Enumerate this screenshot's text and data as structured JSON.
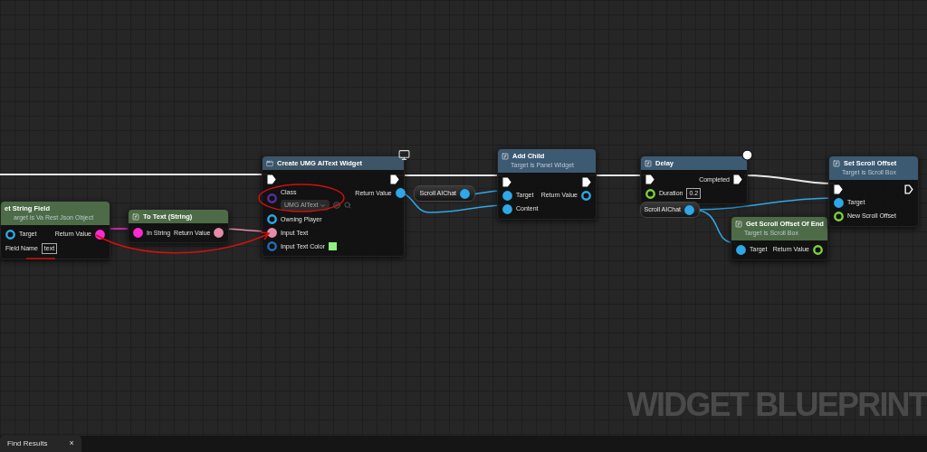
{
  "graph": {
    "nodes": [
      {
        "kind": "function",
        "title": "et String Field",
        "subtitle": "arget is Va Rest Json Object",
        "color": "#4d6b47",
        "inputs": [
          {
            "kind": "data",
            "label": "Target",
            "color": "#2ea8e8",
            "connected": false
          },
          {
            "kind": "data",
            "label": "Field Name",
            "value": "text"
          }
        ],
        "outputs": [
          {
            "kind": "data",
            "label": "Return Value",
            "color": "#ff2ad4",
            "connected": true
          }
        ]
      },
      {
        "kind": "function",
        "title": "To Text (String)",
        "color": "#4d6b47",
        "inputs": [
          {
            "kind": "data",
            "label": "In String",
            "color": "#ff2ad4",
            "connected": true
          }
        ],
        "outputs": [
          {
            "kind": "data",
            "label": "Return Value",
            "color": "#e88aaa",
            "connected": true
          }
        ]
      },
      {
        "kind": "function",
        "title": "Create UMG AIText Widget",
        "color": "#3d5566",
        "inputs": [
          {
            "kind": "exec",
            "connected": true
          },
          {
            "kind": "class",
            "label": "Class",
            "color": "#5a2ea0",
            "connected": false,
            "dropdown": "UMG AIText"
          },
          {
            "kind": "data",
            "label": "Owning Player",
            "color": "#2ea8e8",
            "connected": false
          },
          {
            "kind": "data",
            "label": "Input Text",
            "color": "#e88aaa",
            "connected": true
          },
          {
            "kind": "data",
            "label": "Input Text Color",
            "color": "#1f6fb8",
            "connected": false,
            "swatch": {
              "color": "#8ef07f"
            }
          }
        ],
        "outputs": [
          {
            "kind": "exec",
            "connected": true
          },
          {
            "kind": "data",
            "label": "Return Value",
            "color": "#2ea8e8",
            "connected": true
          }
        ]
      },
      {
        "kind": "variable",
        "title": "Scroll AIChat",
        "color": "#2ea8e8",
        "connected": true
      },
      {
        "kind": "function",
        "title": "Add Child",
        "subtitle": "Target is Panel Widget",
        "color": "#3d5a73",
        "inputs": [
          {
            "kind": "exec",
            "connected": true
          },
          {
            "kind": "data",
            "label": "Target",
            "color": "#2ea8e8",
            "connected": true
          },
          {
            "kind": "data",
            "label": "Content",
            "color": "#2ea8e8",
            "connected": true
          }
        ],
        "outputs": [
          {
            "kind": "exec",
            "connected": true
          },
          {
            "kind": "data",
            "label": "Return Value",
            "color": "#2ea8e8",
            "connected": false
          }
        ]
      },
      {
        "kind": "function",
        "title": "Delay",
        "color": "#3d5a73",
        "inputs": [
          {
            "kind": "exec",
            "connected": true
          },
          {
            "kind": "data",
            "label": "Duration",
            "color": "#7fd13b",
            "connected": false,
            "value": "0.2"
          }
        ],
        "outputs": [
          {
            "kind": "exec",
            "label": "Completed",
            "connected": true
          }
        ]
      },
      {
        "kind": "variable",
        "title": "Scroll AIChat",
        "color": "#2ea8e8",
        "connected": true
      },
      {
        "kind": "function",
        "title": "Get Scroll Offset Of End",
        "subtitle": "Target is Scroll Box",
        "color": "#4d6b47",
        "inputs": [
          {
            "kind": "data",
            "label": "Target",
            "color": "#2ea8e8",
            "connected": true
          }
        ],
        "outputs": [
          {
            "kind": "data",
            "label": "Return Value",
            "color": "#7fd13b",
            "connected": false
          }
        ]
      },
      {
        "kind": "function",
        "title": "Set Scroll Offset",
        "subtitle": "Target is Scroll Box",
        "color": "#3d5a73",
        "inputs": [
          {
            "kind": "exec",
            "connected": true
          },
          {
            "kind": "data",
            "label": "Target",
            "color": "#2ea8e8",
            "connected": true
          },
          {
            "kind": "data",
            "label": "New Scroll Offset",
            "color": "#7fd13b",
            "connected": false
          }
        ],
        "outputs": [
          {
            "kind": "exec",
            "connected": false
          }
        ]
      }
    ]
  },
  "watermark": "WIDGET BLUEPRINT",
  "bottom_tabs": [
    {
      "label": "Find Results",
      "close": "×",
      "selected": true
    }
  ]
}
